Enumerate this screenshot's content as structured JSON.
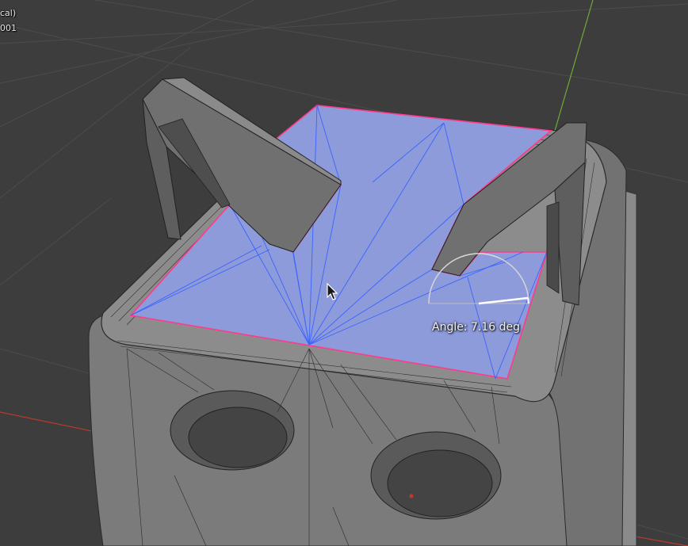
{
  "overlay": {
    "view_name": "cal)",
    "object_name": "001"
  },
  "tool": {
    "angle_label": "Angle: 7.16 deg",
    "angle_value_deg": 7.16
  },
  "colors": {
    "background": "#3d3d3d",
    "grid": "#4a4a4a",
    "x_axis": "#c0392b",
    "y_axis": "#7dbb3c",
    "selected_face": "#8f9cdc",
    "edge_highlight": "#ff3a8c",
    "wire_selected": "#2f5cff",
    "mesh_body": "#7f7f7f",
    "mesh_dark": "#555555",
    "wire": "#2a2a2a"
  },
  "icons": {
    "cursor": "mouse-pointer-icon",
    "angle_gizmo": "angle-protractor-icon"
  }
}
